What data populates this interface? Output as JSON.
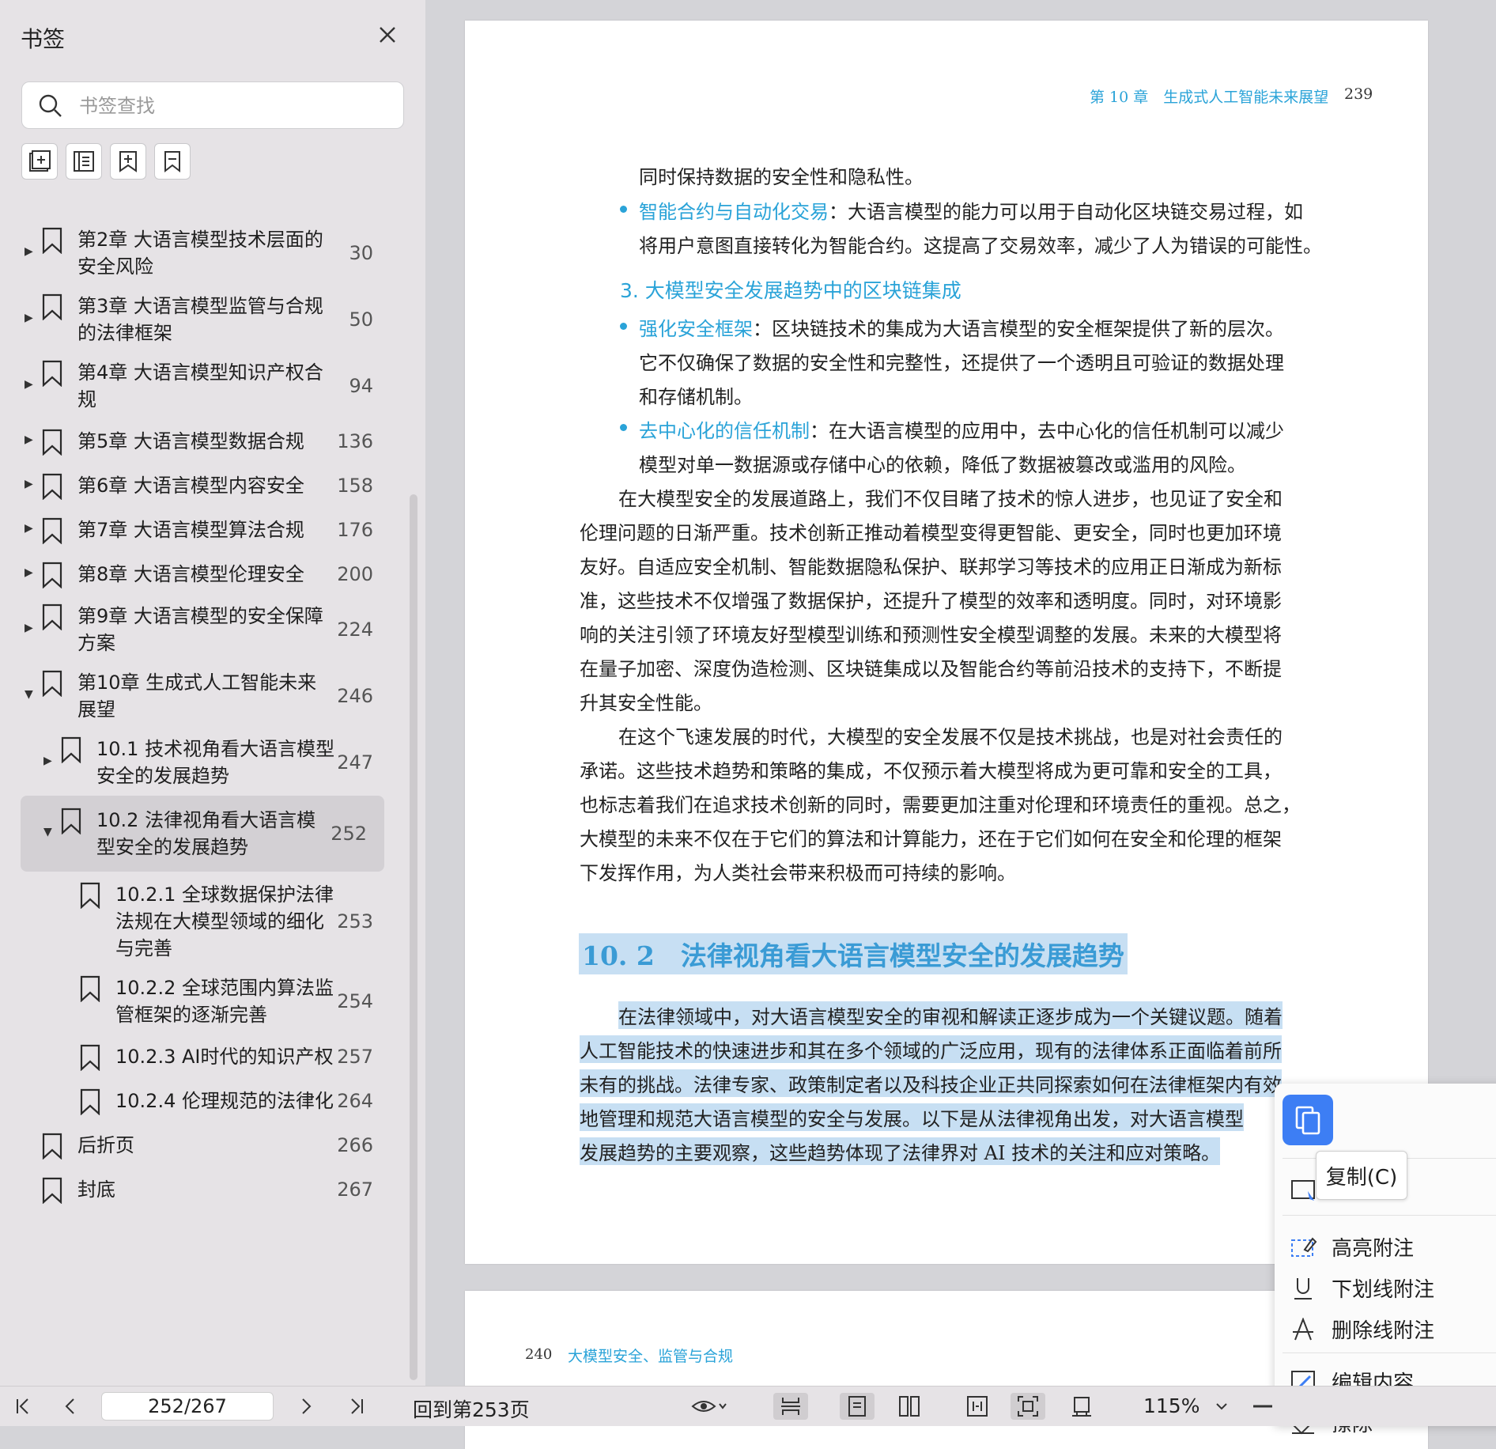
{
  "sidebar": {
    "title": "书签",
    "search_placeholder": "书签查找",
    "items": [
      {
        "label1": "第2章 大语言模型技术层面的",
        "label2": "安全风险",
        "page": "30"
      },
      {
        "label1": "第3章 大语言模型监管与合规",
        "label2": "的法律框架",
        "page": "50"
      },
      {
        "label1": "第4章 大语言模型知识产权合",
        "label2": "规",
        "page": "94"
      },
      {
        "label1": "第5章 大语言模型数据合规",
        "page": "136"
      },
      {
        "label1": "第6章 大语言模型内容安全",
        "page": "158"
      },
      {
        "label1": "第7章 大语言模型算法合规",
        "page": "176"
      },
      {
        "label1": "第8章 大语言模型伦理安全",
        "page": "200"
      },
      {
        "label1": "第9章 大语言模型的安全保障",
        "label2": "方案",
        "page": "224"
      },
      {
        "label1": "第10章 生成式人工智能未来",
        "label2": "展望",
        "page": "246"
      },
      {
        "label1": "10.1 技术视角看大语言模型",
        "label2": "安全的发展趋势",
        "page": "247"
      },
      {
        "label1": "10.2 法律视角看大语言模",
        "label2": "型安全的发展趋势",
        "page": "252"
      },
      {
        "label1": "10.2.1 全球数据保护法律",
        "label2": "法规在大模型领域的细化",
        "label3": "与完善",
        "page": "253"
      },
      {
        "label1": "10.2.2 全球范围内算法监",
        "label2": "管框架的逐渐完善",
        "page": "254"
      },
      {
        "label1": "10.2.3 AI时代的知识产权",
        "page": "257"
      },
      {
        "label1": "10.2.4 伦理规范的法律化",
        "page": "264"
      },
      {
        "label1": "后折页",
        "page": "266"
      },
      {
        "label1": "封底",
        "page": "267"
      }
    ]
  },
  "document": {
    "header_chapter": "第 10 章　生成式人工智能未来展望",
    "header_page": "239",
    "lines": {
      "l1": "同时保持数据的安全性和隐私性。",
      "b1_term": "智能合约与自动化交易",
      "b1_rest": "：大语言模型的能力可以用于自动化区块链交易过程，如",
      "b1_l2": "将用户意图直接转化为智能合约。这提高了交易效率，减少了人为错误的可能性。",
      "subhead": "3. 大模型安全发展趋势中的区块链集成",
      "b2_term": "强化安全框架",
      "b2_rest": "：区块链技术的集成为大语言模型的安全框架提供了新的层次。",
      "b2_l2": "它不仅确保了数据的安全性和完整性，还提供了一个透明且可验证的数据处理",
      "b2_l3": "和存储机制。",
      "b3_term": "去中心化的信任机制",
      "b3_rest": "：在大语言模型的应用中，去中心化的信任机制可以减少",
      "b3_l2": "模型对单一数据源或存储中心的依赖，降低了数据被篡改或滥用的风险。",
      "p1_1": "在大模型安全的发展道路上，我们不仅目睹了技术的惊人进步，也见证了安全和",
      "p1_2": "伦理问题的日渐严重。技术创新正推动着模型变得更智能、更安全，同时也更加环境",
      "p1_3": "友好。自适应安全机制、智能数据隐私保护、联邦学习等技术的应用正日渐成为新标",
      "p1_4": "准，这些技术不仅增强了数据保护，还提升了模型的效率和透明度。同时，对环境影",
      "p1_5": "响的关注引领了环境友好型模型训练和预测性安全模型调整的发展。未来的大模型将",
      "p1_6": "在量子加密、深度伪造检测、区块链集成以及智能合约等前沿技术的支持下，不断提",
      "p1_7": "升其安全性能。",
      "p2_1": "在这个飞速发展的时代，大模型的安全发展不仅是技术挑战，也是对社会责任的",
      "p2_2": "承诺。这些技术趋势和策略的集成，不仅预示着大模型将成为更可靠和安全的工具，",
      "p2_3": "也标志着我们在追求技术创新的同时，需要更加注重对伦理和环境责任的重视。总之，",
      "p2_4": "大模型的未来不仅在于它们的算法和计算能力，还在于它们如何在安全和伦理的框架",
      "p2_5": "下发挥作用，为人类社会带来积极而可持续的影响。",
      "sec_title": "10. 2　法律视角看大语言模型安全的发展趋势",
      "s1": "在法律领域中，对大语言模型安全的审视和解读正逐步成为一个关键议题。随着",
      "s2": "人工智能技术的快速进步和其在多个领域的广泛应用，现有的法律体系正面临着前所",
      "s3": "未有的挑战。法律专家、政策制定者以及科技企业正共同探索如何在法律框架内有效",
      "s4": "地管理和规范大语言模型的安全与发展。以下是从法律视角出发，对大语言模型",
      "s5": "发展趋势的主要观察，这些趋势体现了法律界对 AI 技术的关注和应对策略。"
    },
    "page2_num": "240",
    "page2_title": "大模型安全、监管与合规"
  },
  "context_menu": {
    "tooltip": "复制(C)",
    "items": [
      "高亮附注",
      "下划线附注",
      "删除线附注",
      "编辑内容",
      "擦除"
    ]
  },
  "toolbar": {
    "page_input": "252/267",
    "goto": "回到第253页",
    "zoom": "115%"
  },
  "colors": {
    "accent": "#2aa3d8",
    "selection": "#c7dff3",
    "menu_blue": "#3d7ef4"
  }
}
